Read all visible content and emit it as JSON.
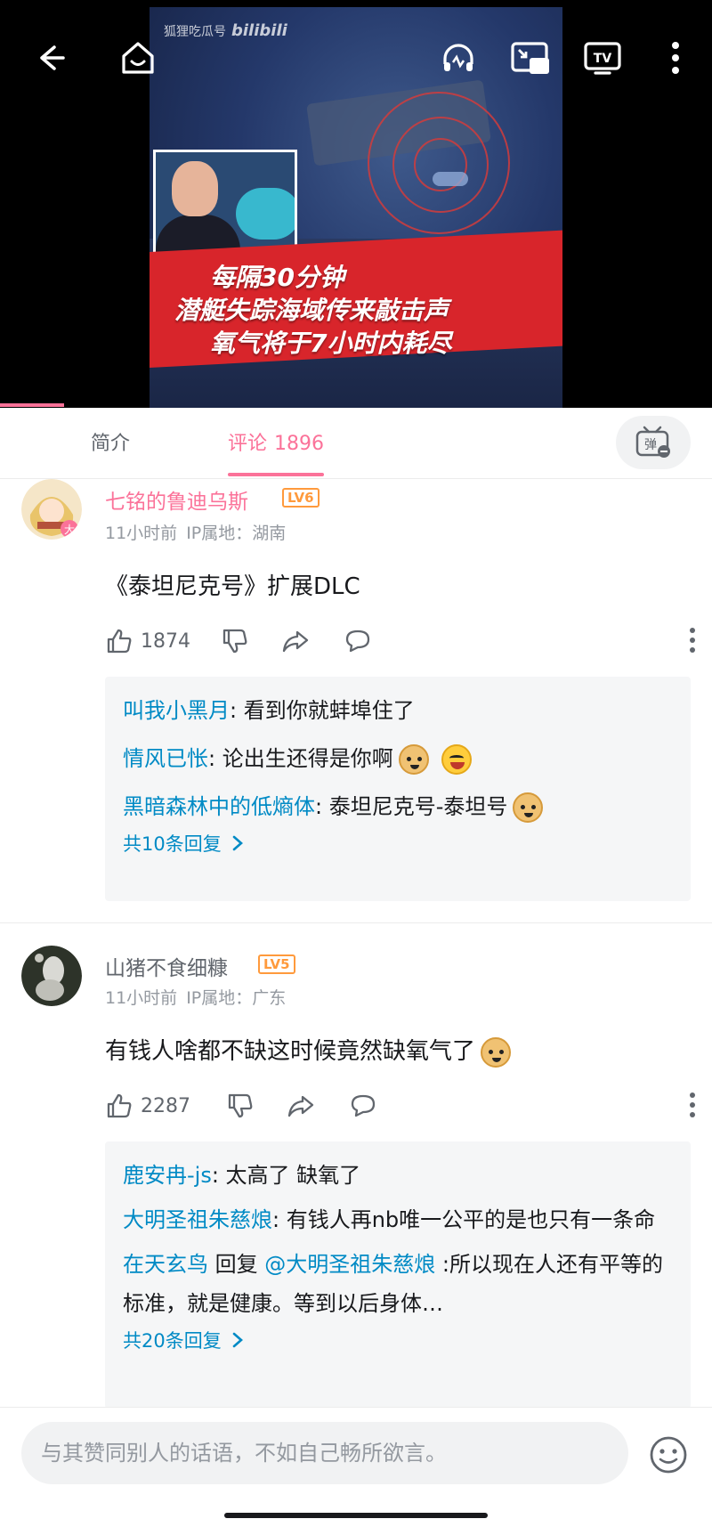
{
  "video": {
    "watermark_text": "狐狸吃瓜号",
    "watermark_logo": "bilibili",
    "headline_lines": [
      "每隔30分钟",
      "潜艇失踪海域传来敲击声",
      "氧气将于7小时内耗尽"
    ],
    "toolbar_icons": [
      "back-icon",
      "home-icon",
      "audio-icon",
      "pip-icon",
      "cast-tv-icon",
      "more-icon"
    ],
    "progress": 0.09
  },
  "tabs": {
    "intro": "简介",
    "comments": "评论",
    "comments_count": "1896",
    "danmaku_icon": "danmaku-toggle-icon"
  },
  "comments": [
    {
      "username": "七铭的鲁迪乌斯",
      "username_color": "#fb7299",
      "level": "LV6",
      "time": "11小时前",
      "ip": "IP属地：湖南",
      "content": "《泰坦尼克号》扩展DLC",
      "likes": "1874",
      "replies": [
        {
          "name": "叫我小黑月",
          "text": ": 看到你就蚌埠住了"
        },
        {
          "name": "情风已怅",
          "text": ": 论出生还得是你啊"
        },
        {
          "name": "黑暗森林中的低熵体",
          "text": ": 泰坦尼克号-泰坦号"
        }
      ],
      "total_replies": "共10条回复"
    },
    {
      "username": "山猪不食细糠",
      "username_color": "#61666d",
      "level": "LV5",
      "time": "11小时前",
      "ip": "IP属地：广东",
      "content": "有钱人啥都不缺这时候竟然缺氧气了",
      "likes": "2287",
      "replies": [
        {
          "name": "鹿安冉-js",
          "text": ": 太高了 缺氧了"
        },
        {
          "name": "大明圣祖朱慈烺",
          "text": ": 有钱人再nb唯一公平的是也只有一条命"
        },
        {
          "name": "在天玄鸟",
          "reply_word": " 回复 ",
          "at": "@大明圣祖朱慈烺",
          "text": " :所以现在人还有平等的标准，就是健康。等到以后身体…"
        }
      ],
      "total_replies": "共20条回复"
    }
  ],
  "input": {
    "placeholder": "与其赞同别人的话语，不如自己畅所欲言。"
  }
}
